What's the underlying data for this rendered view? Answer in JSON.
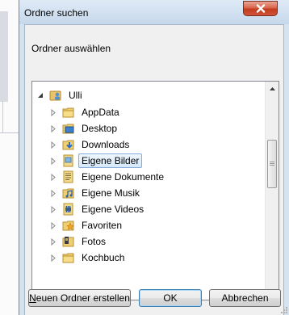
{
  "dialog": {
    "title": "Ordner suchen",
    "instruction": "Ordner auswählen"
  },
  "tree": {
    "root": {
      "label": "Ulli",
      "expanded": true
    },
    "items": [
      {
        "label": "AppData",
        "icon": "folder-icon"
      },
      {
        "label": "Desktop",
        "icon": "desktop-folder-icon"
      },
      {
        "label": "Downloads",
        "icon": "downloads-folder-icon"
      },
      {
        "label": "Eigene Bilder",
        "icon": "pictures-library-icon",
        "selected": true
      },
      {
        "label": "Eigene Dokumente",
        "icon": "documents-library-icon"
      },
      {
        "label": "Eigene Musik",
        "icon": "music-library-icon"
      },
      {
        "label": "Eigene Videos",
        "icon": "videos-library-icon"
      },
      {
        "label": "Favoriten",
        "icon": "favorites-folder-icon"
      },
      {
        "label": "Fotos",
        "icon": "photos-folder-icon"
      },
      {
        "label": "Kochbuch",
        "icon": "folder-icon"
      }
    ]
  },
  "buttons": {
    "new_folder_prefix": "N",
    "new_folder_rest": "euen Ordner erstellen",
    "ok": "OK",
    "cancel": "Abbrechen"
  },
  "colors": {
    "selection_border": "#84acdd",
    "close_button": "#c23b1f",
    "title_bar": "#c6d8ec"
  }
}
